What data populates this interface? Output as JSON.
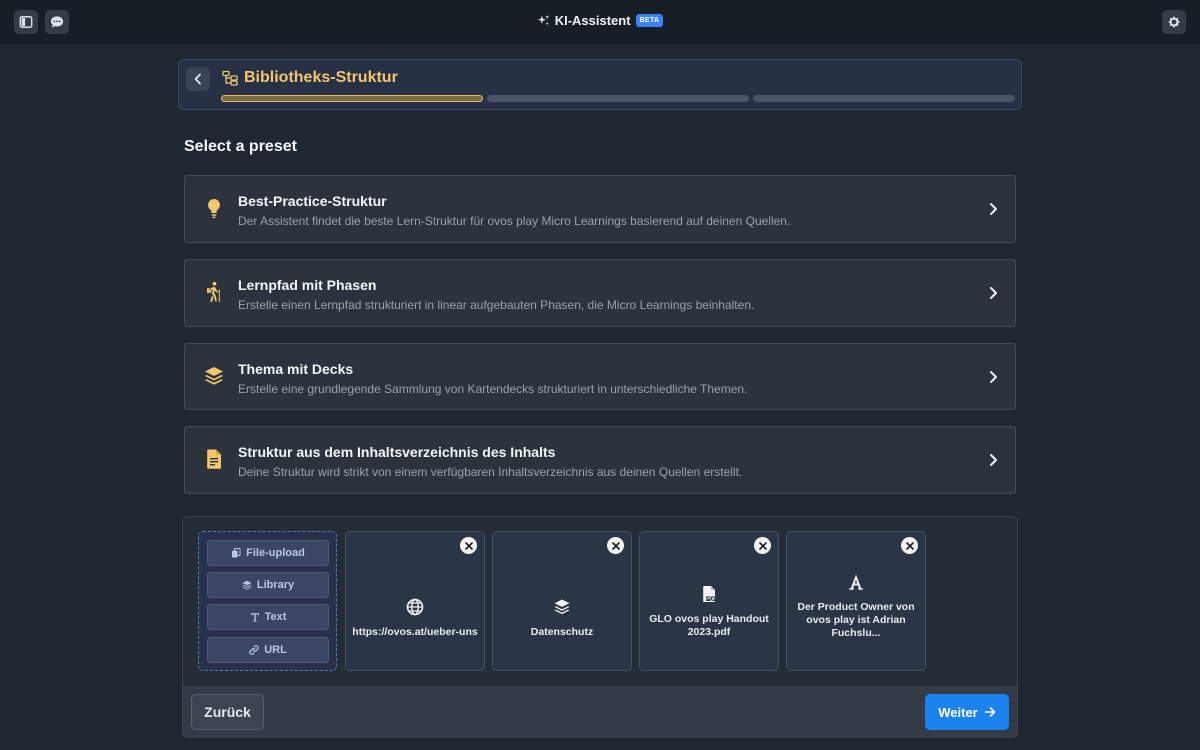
{
  "topbar": {
    "app_title": "KI-Assistent",
    "badge": "BETA",
    "left_icons": [
      "sidebar-icon",
      "chat-icon"
    ],
    "right_icon": "gear-icon"
  },
  "header": {
    "title": "Bibliotheks-Struktur",
    "steps_total": 3,
    "step_active": 1
  },
  "section_title": "Select a preset",
  "presets": [
    {
      "icon": "lightbulb-icon",
      "title": "Best-Practice-Struktur",
      "description": "Der Assistent findet die beste Lern-Struktur für ovos play Micro Learnings basierend auf deinen Quellen."
    },
    {
      "icon": "hiker-icon",
      "title": "Lernpfad mit Phasen",
      "description": "Erstelle einen Lernpfad strukturiert in linear aufgebauten Phasen, die Micro Learnings beinhalten."
    },
    {
      "icon": "layers-icon",
      "title": "Thema mit Decks",
      "description": "Erstelle eine grundlegende Sammlung von Kartendecks strukturiert in unterschiedliche Themen."
    },
    {
      "icon": "document-icon",
      "title": "Struktur aus dem Inhaltsverzeichnis des Inhalts",
      "description": "Deine Struktur wird strikt von einem verfügbaren Inhaltsverzeichnis aus deinen Quellen erstellt."
    }
  ],
  "add_source": {
    "buttons": [
      {
        "label": "File-upload",
        "icon": "file-copy-icon"
      },
      {
        "label": "Library",
        "icon": "layers-icon"
      },
      {
        "label": "Text",
        "icon": "text-icon"
      },
      {
        "label": "URL",
        "icon": "link-icon"
      }
    ]
  },
  "sources": [
    {
      "icon": "globe-icon",
      "label": "https://ovos.at/ueber-uns"
    },
    {
      "icon": "layers-icon",
      "label": "Datenschutz"
    },
    {
      "icon": "pdf-icon",
      "label": "GLO ovos play Handout 2023.pdf"
    },
    {
      "icon": "text-a-icon",
      "label": "Der Product Owner von ovos play ist Adrian Fuchslu..."
    }
  ],
  "footer": {
    "back_label": "Zurück",
    "next_label": "Weiter"
  },
  "colors": {
    "accent": "#f2c66d",
    "primary_button": "#1c82f0",
    "background": "#1f2731"
  }
}
